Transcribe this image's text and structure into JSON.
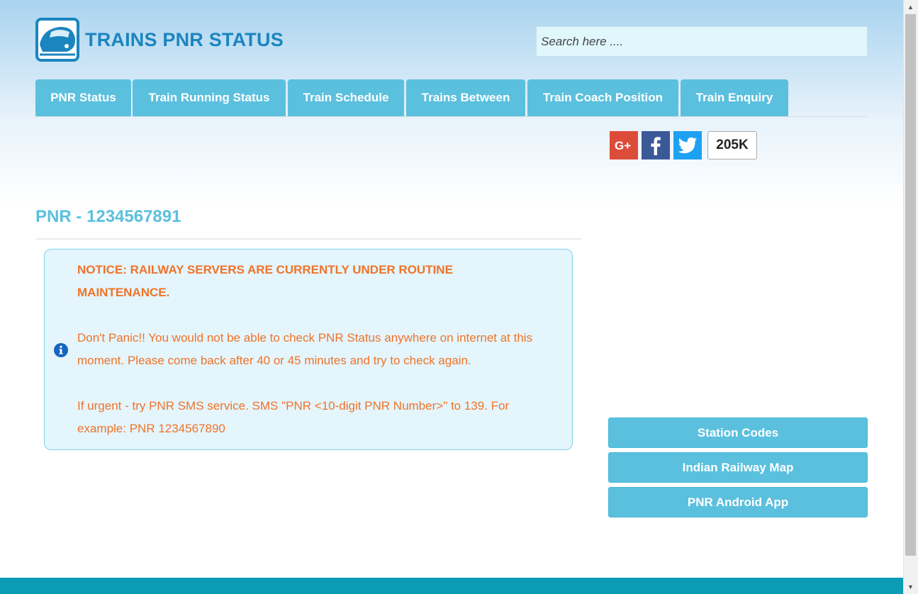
{
  "header": {
    "brand": "TRAINS PNR STATUS",
    "search_placeholder": "Search here ...."
  },
  "nav": {
    "tabs": [
      {
        "label": "PNR Status"
      },
      {
        "label": "Train Running Status"
      },
      {
        "label": "Train Schedule"
      },
      {
        "label": "Trains Between"
      },
      {
        "label": "Train Coach Position"
      },
      {
        "label": "Train Enquiry"
      }
    ]
  },
  "social": {
    "icons": [
      "google-plus-icon",
      "facebook-icon",
      "twitter-icon"
    ],
    "share_count": "205K"
  },
  "main": {
    "title": "PNR - 1234567891",
    "notice": {
      "heading": "NOTICE: RAILWAY SERVERS ARE CURRENTLY UNDER ROUTINE MAINTENANCE.",
      "message": "Don't Panic!! You would not be able to check PNR Status anywhere on internet at this moment. Please come back after 40 or 45 minutes and try to check again.",
      "tip": "If urgent - try PNR SMS service. SMS \"PNR <10-digit PNR Number>\" to 139. For example: PNR 1234567890"
    }
  },
  "sidebar": {
    "buttons": [
      {
        "label": "Station Codes"
      },
      {
        "label": "Indian Railway Map"
      },
      {
        "label": "PNR Android App"
      }
    ]
  },
  "colors": {
    "accent": "#5bc0de",
    "brand": "#1b85bf",
    "notice_text": "#f0732a",
    "footer": "#0d9cb6"
  }
}
